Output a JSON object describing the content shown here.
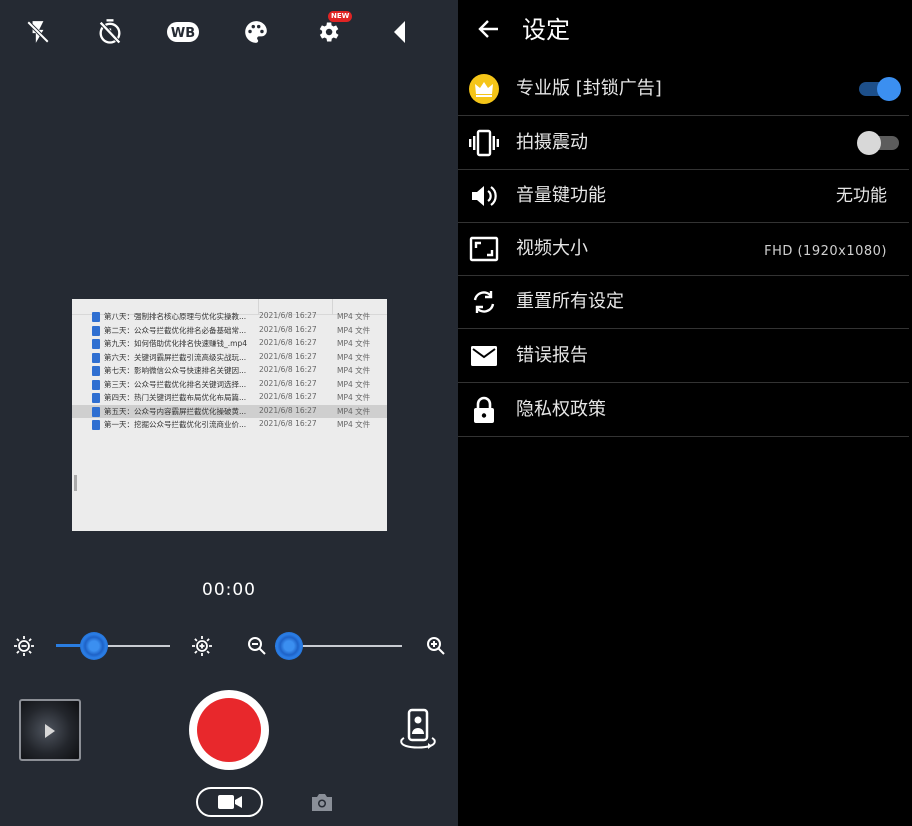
{
  "camera": {
    "top_icons": [
      "flash-off-icon",
      "self-timer-icon",
      "white-balance-icon",
      "filter-palette-icon",
      "settings-gear-icon",
      "collapse-arrow-icon"
    ],
    "new_badge": "NEW",
    "preview": {
      "rows": [
        {
          "name": "第八天：强制排名核心原理与优化实操教...",
          "date": "2021/6/8 16:27",
          "type": "MP4 文件"
        },
        {
          "name": "第二天：公众号拦截优化排名必备基础常...",
          "date": "2021/6/8 16:27",
          "type": "MP4 文件"
        },
        {
          "name": "第九天：如何借助优化排名快速赚钱_.mp4",
          "date": "2021/6/8 16:27",
          "type": "MP4 文件"
        },
        {
          "name": "第六天：关键词霸屏拦截引流高级实战玩...",
          "date": "2021/6/8 16:27",
          "type": "MP4 文件"
        },
        {
          "name": "第七天：影响微信公众号快速排名关键因...",
          "date": "2021/6/8 16:27",
          "type": "MP4 文件"
        },
        {
          "name": "第三天：公众号拦截优化排名关键词选择...",
          "date": "2021/6/8 16:27",
          "type": "MP4 文件"
        },
        {
          "name": "第四天：热门关键词拦截布局优化布局篇...",
          "date": "2021/6/8 16:27",
          "type": "MP4 文件"
        },
        {
          "name": "第五天：公众号内容霸屏拦截优化操破黄...",
          "date": "2021/6/8 16:27",
          "type": "MP4 文件"
        },
        {
          "name": "第一天：挖掘公众号拦截优化引流商业价...",
          "date": "2021/6/8 16:27",
          "type": "MP4 文件"
        }
      ],
      "selected_index": 7
    },
    "timer": "00:00",
    "exposure_level": 0.33,
    "zoom_level": 0.0,
    "mode": "video"
  },
  "settings": {
    "title": "设定",
    "items": [
      {
        "label": "专业版 [封锁广告]",
        "icon": "crown-icon",
        "toggle": true
      },
      {
        "label": "拍摄震动",
        "icon": "vibrate-icon",
        "toggle": false
      },
      {
        "label": "音量键功能",
        "icon": "volume-icon",
        "value": "无功能"
      },
      {
        "label": "视频大小",
        "icon": "video-size-icon",
        "value": "FHD (1920x1080)"
      },
      {
        "label": "重置所有设定",
        "icon": "reset-icon"
      },
      {
        "label": "错误报告",
        "icon": "mail-icon"
      },
      {
        "label": "隐私权政策",
        "icon": "lock-icon"
      }
    ],
    "colors": {
      "accent": "#3b8ff0",
      "record": "#e8282c",
      "crown": "#f5c518"
    }
  }
}
